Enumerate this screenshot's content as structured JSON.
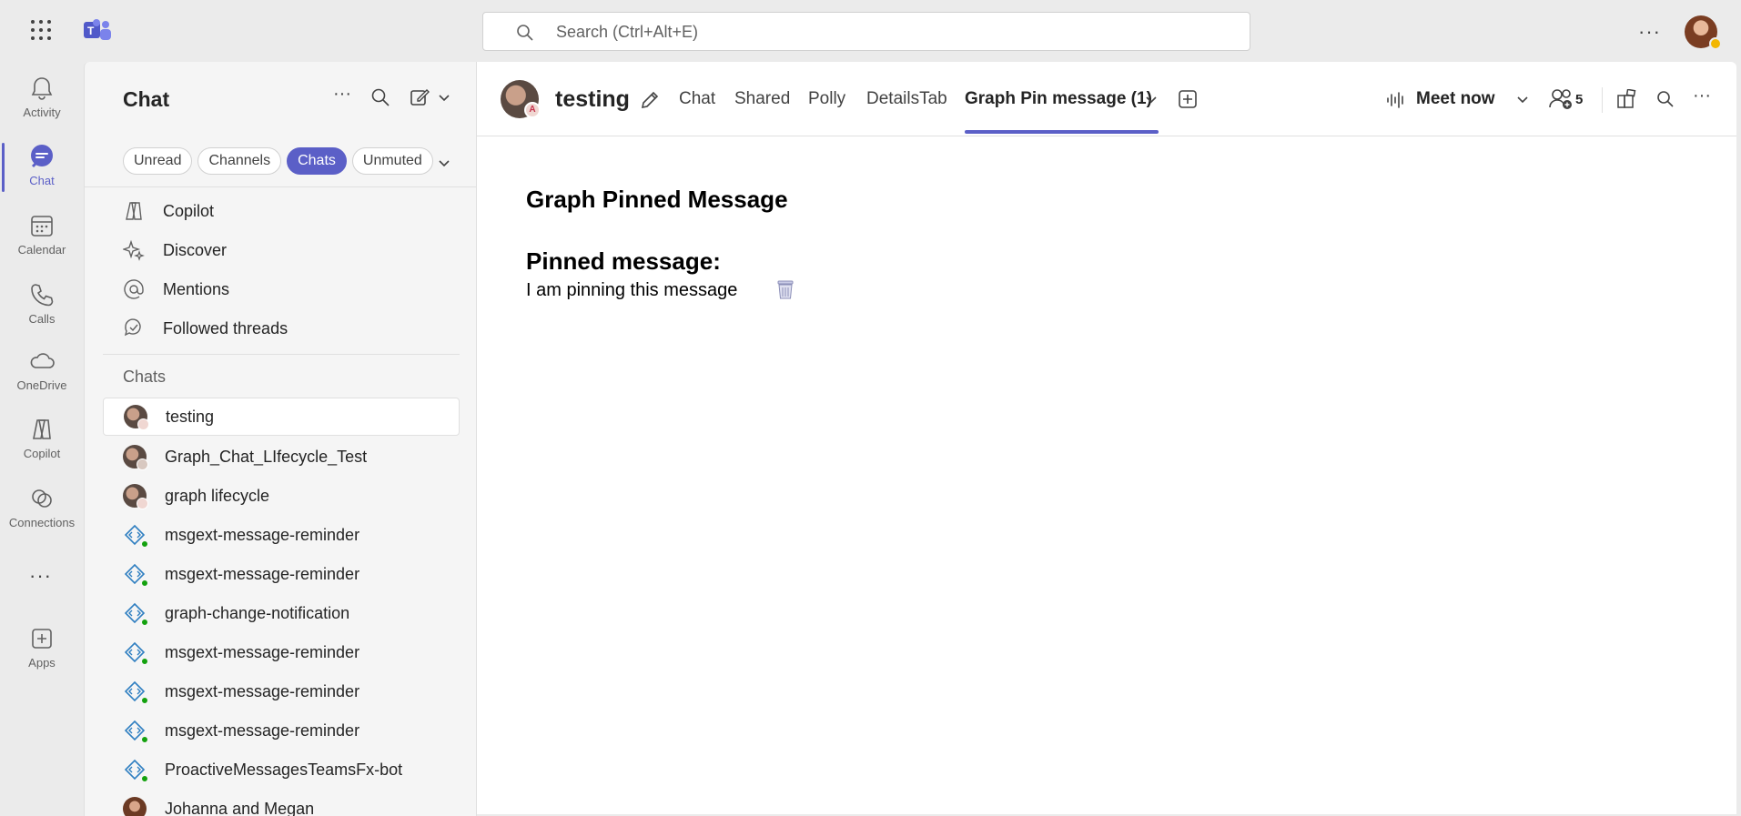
{
  "titlebar": {
    "search_placeholder": "Search (Ctrl+Alt+E)",
    "more": "···"
  },
  "rail": {
    "items": [
      {
        "label": "Activity",
        "icon": "bell-icon"
      },
      {
        "label": "Chat",
        "icon": "chat-icon",
        "active": true
      },
      {
        "label": "Calendar",
        "icon": "calendar-icon"
      },
      {
        "label": "Calls",
        "icon": "phone-icon"
      },
      {
        "label": "OneDrive",
        "icon": "cloud-icon"
      },
      {
        "label": "Copilot",
        "icon": "copilot-icon"
      },
      {
        "label": "Connections",
        "icon": "connections-icon"
      },
      {
        "label": "Apps",
        "icon": "add-app-icon"
      }
    ],
    "more": "···"
  },
  "leftpane": {
    "title": "Chat",
    "more": "···",
    "filters": [
      "Unread",
      "Channels",
      "Chats",
      "Unmuted"
    ],
    "active_filter": "Chats",
    "nav": [
      {
        "label": "Copilot",
        "icon": "copilot-icon"
      },
      {
        "label": "Discover",
        "icon": "sparkle-icon"
      },
      {
        "label": "Mentions",
        "icon": "at-icon"
      },
      {
        "label": "Followed threads",
        "icon": "followed-threads-icon"
      }
    ],
    "chats_label": "Chats",
    "chats": [
      {
        "name": "testing",
        "avatar": "group",
        "selected": true
      },
      {
        "name": "Graph_Chat_LIfecycle_Test",
        "avatar": "group"
      },
      {
        "name": "graph lifecycle",
        "avatar": "group"
      },
      {
        "name": "msgext-message-reminder",
        "avatar": "bot"
      },
      {
        "name": "msgext-message-reminder",
        "avatar": "bot"
      },
      {
        "name": "graph-change-notification",
        "avatar": "bot"
      },
      {
        "name": "msgext-message-reminder",
        "avatar": "bot"
      },
      {
        "name": "msgext-message-reminder",
        "avatar": "bot"
      },
      {
        "name": "msgext-message-reminder",
        "avatar": "bot"
      },
      {
        "name": "ProactiveMessagesTeamsFx-bot",
        "avatar": "bot"
      },
      {
        "name": "Johanna and Megan",
        "avatar": "person"
      }
    ]
  },
  "main": {
    "chat_name": "testing",
    "tabs": [
      "Chat",
      "Shared",
      "Polly",
      "DetailsTab",
      "Graph Pin message (1)"
    ],
    "active_tab": "Graph Pin message (1)",
    "meet_now": "Meet now",
    "participants": "5",
    "more": "···",
    "content": {
      "heading": "Graph Pinned Message",
      "subheading": "Pinned message:",
      "pinned_text": "I am pinning this message"
    }
  },
  "colors": {
    "accent": "#5b5fc7",
    "online": "#13a10e",
    "away": "#f2b600"
  }
}
